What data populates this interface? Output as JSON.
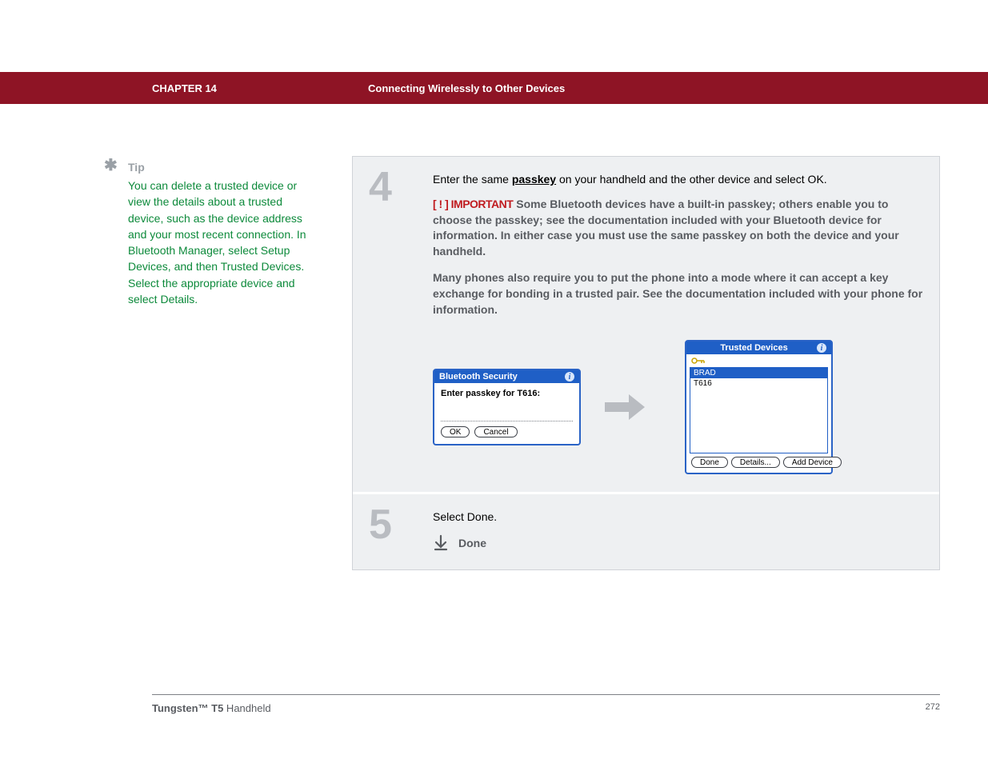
{
  "header": {
    "chapter": "CHAPTER 14",
    "title": "Connecting Wirelessly to Other Devices"
  },
  "tip": {
    "heading": "Tip",
    "body": "You can delete a trusted device or view the details about a trusted device, such as the device address and your most recent connection. In Bluetooth Manager, select Setup Devices, and then Trusted Devices. Select the appropriate device and select Details."
  },
  "step4": {
    "number": "4",
    "instr_pre": "Enter the same ",
    "instr_link": "passkey",
    "instr_post": " on your handheld and the other device and select OK.",
    "important_prefix": "[ ! ] IMPORTANT",
    "important_body": " Some Bluetooth devices have a built-in passkey; others enable you to choose the passkey; see the documentation included with your Bluetooth device for information. In either case you must use the same passkey on both the device and your handheld.",
    "important_para2": "Many phones also require you to put the phone into a mode where it can accept a key exchange for bonding in a trusted pair. See the documentation included with your phone for information.",
    "bt_title": "Bluetooth Security",
    "bt_prompt": "Enter passkey for T616:",
    "bt_ok": "OK",
    "bt_cancel": "Cancel",
    "td_title": "Trusted Devices",
    "td_items": [
      "BRAD",
      "T616"
    ],
    "td_done": "Done",
    "td_details": "Details...",
    "td_add": "Add Device"
  },
  "step5": {
    "number": "5",
    "instr": "Select Done.",
    "done": "Done"
  },
  "footer": {
    "product_bold": "Tungsten™ T5",
    "product_rest": " Handheld",
    "page": "272"
  }
}
